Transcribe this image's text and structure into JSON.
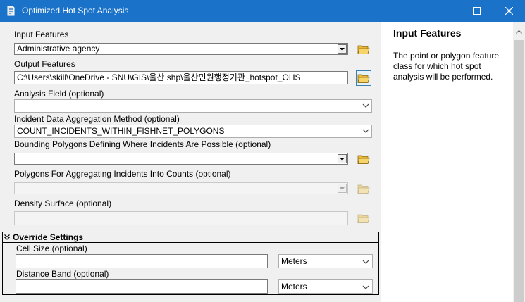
{
  "window": {
    "title": "Optimized Hot Spot Analysis",
    "icon": "python-script-icon"
  },
  "params": {
    "input_features": {
      "label": "Input Features",
      "value": "Administrative agency"
    },
    "output_features": {
      "label": "Output Features",
      "value": "C:\\Users\\skill\\OneDrive - SNU\\GIS\\울산 shp\\울산민원행정기관_hotspot_OHS"
    },
    "analysis_field": {
      "label": "Analysis Field (optional)",
      "value": ""
    },
    "aggregation": {
      "label": "Incident Data Aggregation Method (optional)",
      "value": "COUNT_INCIDENTS_WITHIN_FISHNET_POLYGONS"
    },
    "bounding": {
      "label": "Bounding Polygons Defining Where Incidents Are Possible (optional)",
      "value": ""
    },
    "aggregating_polygons": {
      "label": "Polygons For Aggregating Incidents Into Counts (optional)",
      "value": ""
    },
    "density": {
      "label": "Density Surface (optional)",
      "value": ""
    }
  },
  "override": {
    "title": "Override Settings",
    "cell_size": {
      "label": "Cell Size (optional)",
      "value": "",
      "unit": "Meters"
    },
    "distance_band": {
      "label": "Distance Band (optional)",
      "value": "",
      "unit": "Meters"
    }
  },
  "help": {
    "title": "Input Features",
    "text": "The point or polygon feature class for which hot spot analysis will be performed."
  },
  "colors": {
    "titlebar": "#1a73c8",
    "panel": "#f0f0f0"
  }
}
